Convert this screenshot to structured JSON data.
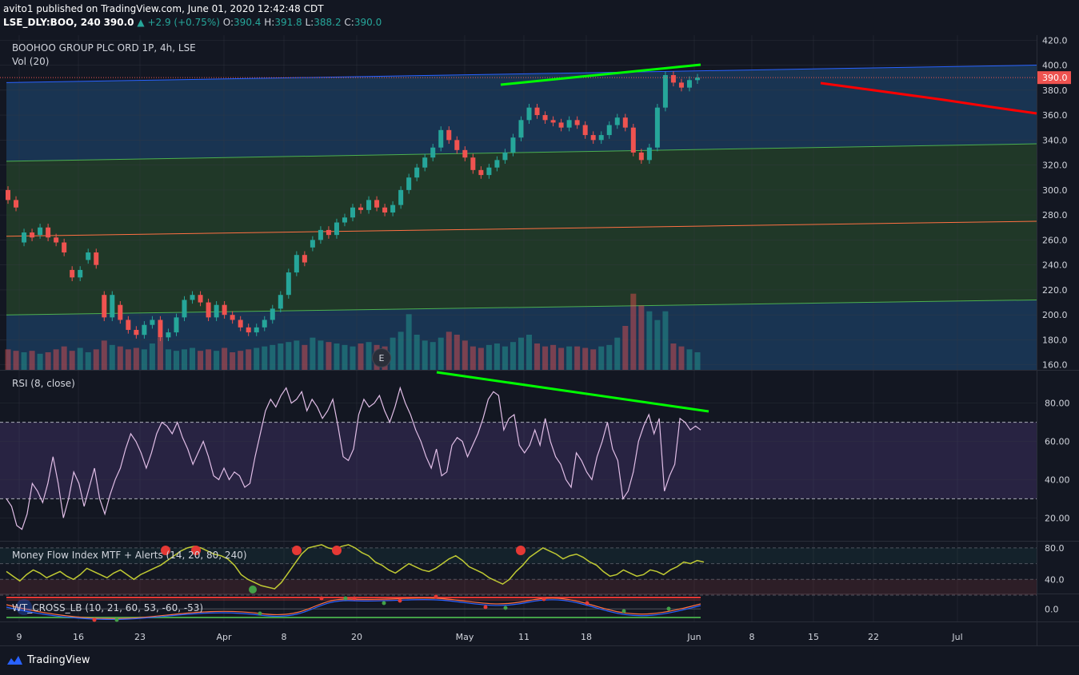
{
  "header": {
    "published": "avito1 published on TradingView.com, June 01, 2020 12:42:48 CDT",
    "symbol": "LSE_DLY:BOO, 240",
    "last": "390.0",
    "change": "+2.9 (+0.75%)",
    "o_label": "O:",
    "o": "390.4",
    "h_label": "H:",
    "h": "391.8",
    "l_label": "L:",
    "l": "388.2",
    "c_label": "C:",
    "c": "390.0"
  },
  "panes": {
    "main_title": "BOOHOO GROUP PLC ORD 1P, 4h, LSE",
    "vol_title": "Vol (20)",
    "rsi_title": "RSI (8, close)",
    "mfi_title": "Money Flow Index MTF + Alerts (14, 20, 80, 240)",
    "wt_title": "WT_CROSS_LB (10, 21, 60, 53, -60, -53)"
  },
  "earnings_badge": "E",
  "branding": {
    "name": "TradingView"
  },
  "colors": {
    "bg": "#131722",
    "up": "#26a69a",
    "down": "#ef5350",
    "trend_green": "#00ff00",
    "trend_red": "#ff0000",
    "channel_blue": "#2962ff",
    "channel_green": "#4caf50",
    "channel_orange": "#ff7043",
    "rsi_line": "#e1bee7",
    "mfi_line": "#c0ca33"
  },
  "chart_data": {
    "type": "candlestick",
    "price_axis": {
      "ticks": [
        "420.0",
        "400.0",
        "380.0",
        "360.0",
        "340.0",
        "320.0",
        "300.0",
        "280.0",
        "260.0",
        "240.0",
        "220.0",
        "200.0",
        "180.0",
        "160.0"
      ],
      "ylim": [
        156,
        424
      ],
      "last_price_label": "390.0",
      "last_price": 390
    },
    "time_axis": {
      "ticks": [
        "9",
        "16",
        "23",
        "Apr",
        "8",
        "20",
        "May",
        "11",
        "18",
        "Jun",
        "8",
        "15",
        "22",
        "Jul"
      ]
    },
    "candles": [
      [
        300,
        292
      ],
      [
        292,
        286
      ],
      [
        258,
        266
      ],
      [
        266,
        262
      ],
      [
        264,
        270
      ],
      [
        270,
        262
      ],
      [
        262,
        258
      ],
      [
        258,
        250
      ],
      [
        236,
        230
      ],
      [
        230,
        236
      ],
      [
        244,
        250
      ],
      [
        250,
        240
      ],
      [
        216,
        198
      ],
      [
        198,
        216
      ],
      [
        208,
        196
      ],
      [
        196,
        188
      ],
      [
        188,
        184
      ],
      [
        184,
        192
      ],
      [
        192,
        196
      ],
      [
        196,
        182
      ],
      [
        182,
        186
      ],
      [
        186,
        198
      ],
      [
        198,
        212
      ],
      [
        212,
        216
      ],
      [
        216,
        210
      ],
      [
        210,
        198
      ],
      [
        198,
        208
      ],
      [
        208,
        200
      ],
      [
        200,
        196
      ],
      [
        196,
        190
      ],
      [
        190,
        186
      ],
      [
        186,
        190
      ],
      [
        190,
        196
      ],
      [
        196,
        205
      ],
      [
        205,
        216
      ],
      [
        216,
        234
      ],
      [
        234,
        248
      ],
      [
        248,
        242
      ],
      [
        254,
        260
      ],
      [
        260,
        268
      ],
      [
        268,
        264
      ],
      [
        264,
        274
      ],
      [
        274,
        278
      ],
      [
        278,
        286
      ],
      [
        286,
        284
      ],
      [
        284,
        292
      ],
      [
        292,
        286
      ],
      [
        286,
        282
      ],
      [
        282,
        288
      ],
      [
        288,
        300
      ],
      [
        300,
        310
      ],
      [
        310,
        318
      ],
      [
        318,
        326
      ],
      [
        326,
        334
      ],
      [
        334,
        348
      ],
      [
        348,
        340
      ],
      [
        340,
        332
      ],
      [
        332,
        326
      ],
      [
        326,
        316
      ],
      [
        316,
        312
      ],
      [
        312,
        318
      ],
      [
        318,
        324
      ],
      [
        324,
        330
      ],
      [
        330,
        342
      ],
      [
        342,
        356
      ],
      [
        356,
        366
      ],
      [
        366,
        360
      ],
      [
        360,
        356
      ],
      [
        356,
        354
      ],
      [
        354,
        350
      ],
      [
        350,
        356
      ],
      [
        356,
        352
      ],
      [
        352,
        344
      ],
      [
        344,
        340
      ],
      [
        340,
        344
      ],
      [
        344,
        352
      ],
      [
        352,
        358
      ],
      [
        358,
        350
      ],
      [
        350,
        330
      ],
      [
        330,
        324
      ],
      [
        324,
        334
      ],
      [
        334,
        366
      ],
      [
        366,
        392
      ],
      [
        392,
        386
      ],
      [
        386,
        382
      ],
      [
        382,
        388
      ],
      [
        388,
        390
      ]
    ],
    "volume": [
      14,
      13,
      12,
      13,
      11,
      12,
      14,
      16,
      13,
      15,
      12,
      14,
      20,
      17,
      16,
      14,
      15,
      14,
      18,
      22,
      14,
      13,
      14,
      15,
      13,
      14,
      13,
      15,
      12,
      13,
      14,
      15,
      16,
      17,
      18,
      19,
      20,
      17,
      22,
      20,
      19,
      18,
      17,
      16,
      18,
      19,
      17,
      16,
      22,
      26,
      38,
      24,
      20,
      19,
      22,
      26,
      24,
      20,
      16,
      15,
      17,
      18,
      16,
      19,
      22,
      24,
      18,
      16,
      17,
      15,
      16,
      16,
      15,
      14,
      16,
      17,
      22,
      30,
      52,
      44,
      40,
      34,
      40,
      18,
      16,
      14,
      12
    ],
    "channel_lines": [
      {
        "y_start": 386,
        "y_end": 400
      },
      {
        "y_start": 323,
        "y_end": 337
      },
      {
        "y_start": 263,
        "y_end": 275
      },
      {
        "y_start": 200,
        "y_end": 212
      }
    ],
    "trendlines": [
      {
        "color": "green",
        "y_start": 386,
        "y_end": 402
      },
      {
        "color": "red",
        "y_start": 387,
        "y_end": 362
      }
    ],
    "rsi": {
      "ticks": [
        "80.00",
        "60.00",
        "40.00",
        "20.00"
      ],
      "ylim": [
        8,
        97
      ],
      "upper_band": 70,
      "lower_band": 30,
      "values": [
        30,
        26,
        16,
        14,
        22,
        38,
        34,
        28,
        38,
        52,
        38,
        20,
        30,
        44,
        38,
        26,
        36,
        46,
        30,
        22,
        32,
        40,
        46,
        56,
        64,
        60,
        54,
        46,
        54,
        64,
        70,
        68,
        64,
        70,
        62,
        56,
        48,
        54,
        60,
        52,
        42,
        40,
        46,
        40,
        44,
        42,
        36,
        38,
        52,
        64,
        76,
        82,
        78,
        84,
        88,
        80,
        82,
        86,
        76,
        82,
        78,
        72,
        76,
        82,
        68,
        52,
        50,
        56,
        74,
        82,
        78,
        80,
        84,
        76,
        70,
        78,
        88,
        80,
        74,
        66,
        60,
        52,
        46,
        56,
        42,
        44,
        58,
        62,
        60,
        52,
        58,
        64,
        72,
        82,
        86,
        84,
        66,
        72,
        74,
        58,
        54,
        58,
        66,
        58,
        72,
        60,
        52,
        48,
        40,
        36,
        54,
        50,
        44,
        40,
        52,
        60,
        70,
        56,
        50,
        30,
        34,
        44,
        60,
        68,
        74,
        64,
        72,
        34,
        42,
        48,
        72,
        70,
        66,
        68,
        66
      ]
    },
    "mfi": {
      "ticks": [
        "80.0",
        "40.0"
      ],
      "ylim": [
        22,
        88
      ],
      "levels": [
        80,
        60,
        40,
        20
      ],
      "values": [
        50,
        44,
        38,
        46,
        52,
        48,
        42,
        46,
        50,
        44,
        40,
        46,
        54,
        50,
        46,
        42,
        48,
        52,
        46,
        40,
        46,
        50,
        54,
        58,
        64,
        70,
        76,
        80,
        82,
        80,
        76,
        72,
        70,
        66,
        58,
        46,
        40,
        36,
        32,
        30,
        28,
        36,
        48,
        60,
        72,
        80,
        82,
        84,
        80,
        78,
        82,
        84,
        80,
        74,
        70,
        62,
        58,
        52,
        48,
        54,
        60,
        56,
        52,
        50,
        54,
        60,
        66,
        70,
        64,
        56,
        52,
        48,
        42,
        38,
        34,
        40,
        50,
        58,
        68,
        74,
        80,
        76,
        72,
        66,
        70,
        72,
        68,
        62,
        58,
        50,
        44,
        46,
        52,
        48,
        44,
        46,
        52,
        50,
        46,
        52,
        56,
        62,
        60,
        64,
        62
      ]
    },
    "wt": {
      "ticks": [
        "0.0"
      ],
      "ylim": [
        -12,
        14
      ],
      "zero": 0
    },
    "annotations": [
      "E"
    ]
  }
}
